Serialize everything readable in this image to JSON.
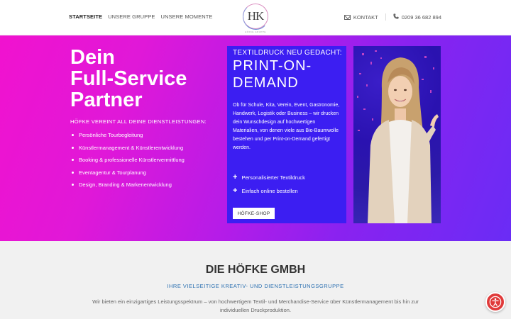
{
  "header": {
    "nav": [
      {
        "label": "STARTSEITE",
        "active": true
      },
      {
        "label": "UNSERE GRUPPE",
        "active": false
      },
      {
        "label": "UNSERE MOMENTE",
        "active": false
      }
    ],
    "logo_text": "HK",
    "logo_sub": "HÖFKE GRUPPE",
    "contact_label": "KONTAKT",
    "phone": "0209 36 682 894"
  },
  "hero": {
    "title": [
      "Dein",
      "Full-Service",
      "Partner"
    ],
    "subtitle": "HÖFKE VEREINT ALL DEINE DIENSTLEISTUNGEN:",
    "services": [
      "Persönliche Tourbegleitung",
      "Künstlermanagement & Künstlerentwicklung",
      "Booking & professionelle Künstlervermittlung",
      "Eventagentur & Tourplanung",
      "Design, Branding & Markenentwicklung"
    ],
    "card": {
      "kicker": "TEXTILDRUCK NEU GEDACHT:",
      "title": [
        "PRINT-ON-",
        "DEMAND"
      ],
      "body": "Ob für Schule, Kita, Verein, Event, Gastronomie, Handwerk, Logistik oder Business – wir drucken dein Wunschdesign auf hochwertigen Materialien, von denen viele aus Bio-Baumwolle bestehen und per Print-on-Demand gefertigt werden.",
      "features": [
        "Personalisierter Textildruck",
        "Einfach online bestellen"
      ],
      "button_label": "HÖFKE-SHOP"
    }
  },
  "section": {
    "title": "DIE HÖFKE GMBH",
    "subtitle": "IHRE VIELSEITIGE KREATIV- UND DIENSTLEISTUNGSGRUPPE",
    "text": "Wir bieten ein einzigartiges Leistungsspektrum – von hochwertigem Textil- und Merchandise-Service über Künstlermanagement bis hin zur individuellen Druckproduktion."
  },
  "colors": {
    "hero_start": "#f112cf",
    "hero_end": "#6a2cf5",
    "card_bg": "#3c1ef2",
    "subtitle_blue": "#2a6fb0",
    "a11y_red": "#e03a3a"
  },
  "icons": [
    "mail-icon",
    "phone-icon",
    "plus-icon",
    "accessibility-icon"
  ]
}
